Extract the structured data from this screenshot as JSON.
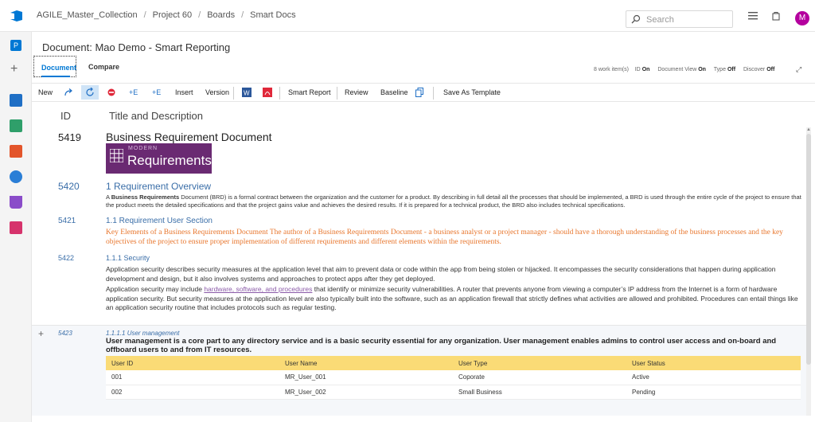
{
  "header": {
    "breadcrumbs": [
      "AGILE_Master_Collection",
      "Project 60",
      "Boards",
      "Smart Docs"
    ],
    "search_placeholder": "Search",
    "avatar_initial": "M"
  },
  "leftnav": {
    "project_initial": "P"
  },
  "document": {
    "title": "Document: Mao Demo - Smart Reporting",
    "tabs": [
      {
        "label": "Document"
      },
      {
        "label": "Compare"
      }
    ],
    "status": {
      "work_items": "8 work item(s)",
      "id_label": "ID",
      "id_value": "On",
      "docview_label": "Document View",
      "docview_value": "On",
      "type_label": "Type",
      "type_value": "Off",
      "discover_label": "Discover",
      "discover_value": "Off"
    }
  },
  "toolbar": {
    "new": "New",
    "add_e1": "+E",
    "add_e2": "+E",
    "insert": "Insert",
    "version": "Version",
    "smart_report": "Smart Report",
    "review": "Review",
    "baseline": "Baseline",
    "save_template": "Save As Template"
  },
  "columns": {
    "id": "ID",
    "title": "Title and Description"
  },
  "items": {
    "i5419": {
      "id": "5419",
      "title": "Business Requirement Document",
      "logo_small": "MODERN",
      "logo_big": "Requirements"
    },
    "i5420": {
      "id": "5420",
      "title": "1  Requirement Overview",
      "desc_pre": "A ",
      "desc_bold": "Business Requirements",
      "desc_rest": " Document (BRD) is a formal contract between the organization and the customer for a product. By describing in full detail all the processes that should be implemented, a BRD is used through the entire cycle of the project to ensure that the product meets the detailed specifications and that the project gains value and achieves the desired results. If it is prepared for a technical product, the BRD also includes technical specifications."
    },
    "i5421": {
      "id": "5421",
      "title": "1.1  Requirement User Section",
      "desc": "Key Elements of a Business Requirements Document The author of a Business Requirements Document - a business analyst or a project manager - should have a thorough understanding of the business processes and the key objectives of the project to ensure proper implementation of different requirements and different elements within the requirements."
    },
    "i5422": {
      "id": "5422",
      "title": "1.1.1  Security",
      "p1": "Application security describes security measures at the application level that aim to prevent data or code within the app from being stolen or hijacked. It encompasses the security considerations that happen during application development and design, but it also involves systems and approaches to protect apps after they get deployed.",
      "p2_pre": "Application security may include ",
      "p2_link": "hardware, software, and procedures",
      "p2_rest": " that identify or minimize security vulnerabilities. A router that prevents anyone from viewing a computer’s IP address from the Internet is a form of hardware application security. But security measures at the application level are also typically built into the software, such as an application firewall that strictly defines what activities are allowed and prohibited. Procedures can entail things like an application security routine that includes protocols such as regular testing."
    },
    "i5423": {
      "id": "5423",
      "title": "1.1.1.1  User management",
      "desc": "User management is a core part to any directory service and is a basic security essential for any organization. User management enables admins to control user access and on-board and offboard users to and from IT resources."
    }
  },
  "user_table": {
    "headers": [
      "User ID",
      "User Name",
      "User Type",
      "User Status"
    ],
    "rows": [
      [
        "001",
        "MR_User_001",
        "Coporate",
        "Active"
      ],
      [
        "002",
        "MR_User_002",
        "Small Business",
        "Pending"
      ]
    ]
  },
  "colors": {
    "accent": "#0078d4",
    "link": "#3a6ea8",
    "orange_text": "#e8762d",
    "table_header": "#fadb76",
    "logo_bg": "#6a2a72"
  }
}
